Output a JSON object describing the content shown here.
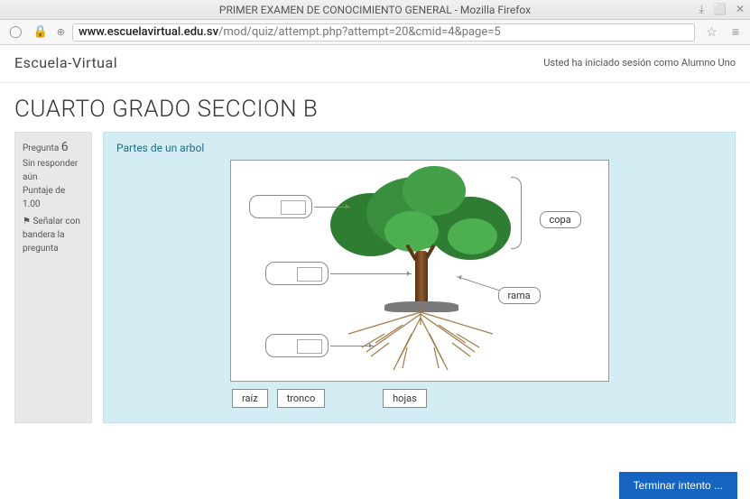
{
  "window": {
    "title": "PRIMER EXAMEN DE CONOCIMIENTO GENERAL - Mozilla Firefox"
  },
  "url": {
    "domain": "www.escuelavirtual.edu.sv",
    "path": "/mod/quiz/attempt.php?attempt=20&cmid=4&page=5"
  },
  "brand": "Escuela-Virtual",
  "session_text": "Usted ha iniciado sesión como Alumno Uno",
  "course_title": "CUARTO GRADO SECCION B",
  "question_info": {
    "label_prefix": "Pregunta ",
    "number": "6",
    "state": "Sin responder aún",
    "points": "Puntaje de 1.00",
    "flag": "Señalar con bandera la pregunta"
  },
  "question_text": "Partes de un arbol",
  "placed": {
    "copa": "copa",
    "rama": "rama"
  },
  "pool": {
    "raiz": "raíz",
    "tronco": "tronco",
    "hojas": "hojas"
  },
  "finish_label": "Terminar intento ..."
}
